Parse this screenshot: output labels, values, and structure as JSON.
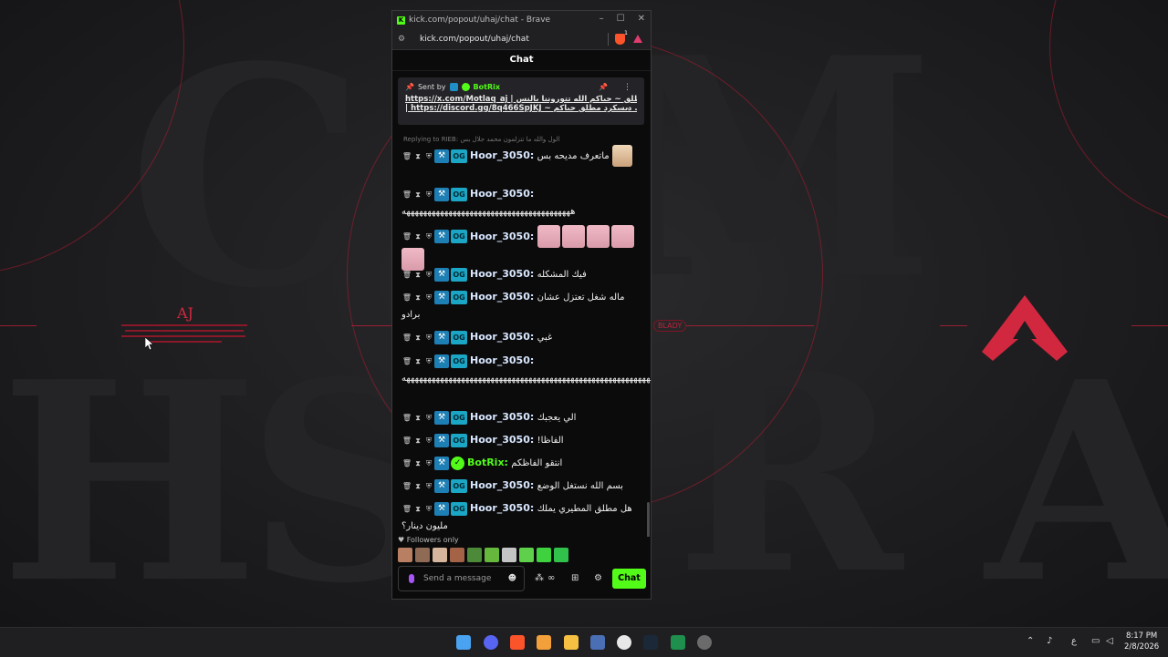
{
  "browser": {
    "title": "kick.com/popout/uhaj/chat - Brave",
    "url": "kick.com/popout/uhaj/chat",
    "shield_count": "1"
  },
  "chat": {
    "header": "Chat",
    "pinned": {
      "sent_by_label": "Sent by",
      "sender": "BotRix",
      "line1": "https://x.com/Motlaq_aj | تويتر مطلق ~ حياكم الله تتوروننا بالنس",
      "line2": "| https://discord.gg/8q466SpJKJ ~ ديسكرد مطلق حياكم ..."
    },
    "reply_note": "Replying to RIEB: الول والله ما تتزلمون محمد جلال بس",
    "messages": [
      {
        "user": "Hoor_3050:",
        "text": "ماتعرف مديحه بس",
        "emotes": 1
      },
      {
        "user": "Hoor_3050:",
        "text": "ههههههههههههههههههههههههههههههههههههههههه",
        "emotes": 0
      },
      {
        "user": "Hoor_3050:",
        "text": "",
        "emotes": 5
      },
      {
        "user": "Hoor_3050:",
        "text": "فيك المشكله",
        "emotes": 0
      },
      {
        "user": "Hoor_3050:",
        "text": "ماله شغل تعتزل عشان برادو",
        "emotes": 0
      },
      {
        "user": "Hoor_3050:",
        "text": "غبي",
        "emotes": 0
      },
      {
        "user": "Hoor_3050:",
        "text": "هههههههههههههههههههههههههههههههههههههههههههههههههههههههههههههههههههههه",
        "emotes": 0
      },
      {
        "user": "Hoor_3050:",
        "text": "الي يعجبك",
        "emotes": 0
      },
      {
        "user": "Hoor_3050:",
        "text": "الفاظا!",
        "emotes": 0
      },
      {
        "user": "BotRix:",
        "text": "انتقو الفاظكم",
        "emotes": 0,
        "bot": true
      },
      {
        "user": "Hoor_3050:",
        "text": "بسم الله نستغل الوضع",
        "emotes": 0
      },
      {
        "user": "Hoor_3050:",
        "text": "هل مطلق المطيري يملك مليون دينار؟",
        "emotes": 0
      }
    ],
    "followers_only": "Followers only",
    "input_placeholder": "Send a message",
    "chat_button": "Chat"
  },
  "wallpaper": {
    "aj": "AJ",
    "blady": "BLADY"
  },
  "taskbar": {
    "time": "8:17 PM",
    "date": "2/8/2026",
    "lang": "ع"
  },
  "colors": {
    "kick_green": "#53fc18",
    "accent_red": "#d2283f",
    "username": "#d9e7ff"
  }
}
